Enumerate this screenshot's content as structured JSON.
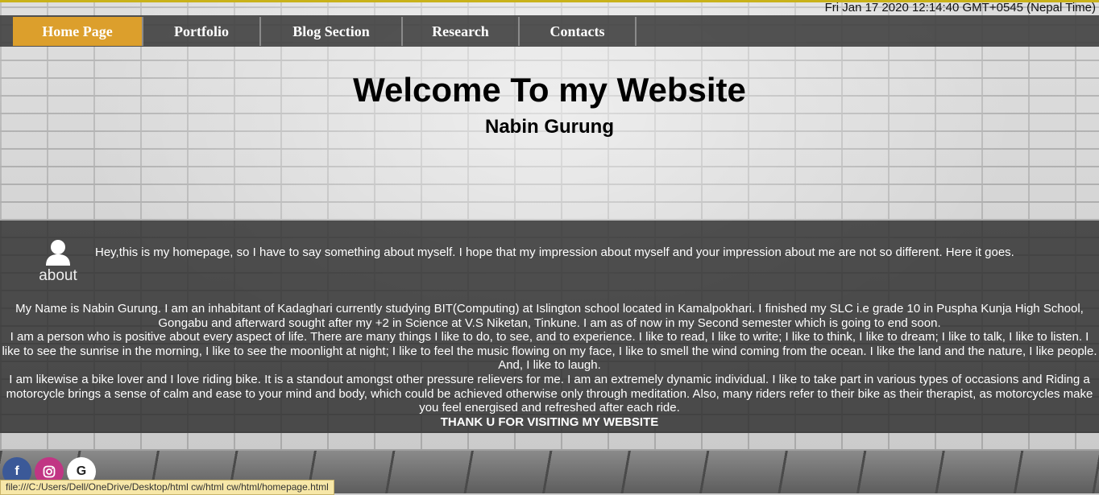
{
  "clock": "Fri Jan 17 2020 12:14:40 GMT+0545 (Nepal Time)",
  "nav": {
    "items": [
      "Home Page",
      "Portfolio",
      "Blog Section",
      "Research",
      "Contacts"
    ],
    "active": "Home Page"
  },
  "hero": {
    "title": "Welcome To my Website",
    "subtitle": "Nabin Gurung"
  },
  "about": {
    "label": "about",
    "intro": "Hey,this is my homepage, so I have to say something about myself. I hope that my impression about myself and your impression about me are not so different. Here it goes.",
    "paragraph1": "My Name is Nabin Gurung. I am an inhabitant of Kadaghari currently studying BIT(Computing) at Islington school located in Kamalpokhari. I finished my SLC i.e grade 10 in Puspha Kunja High School, Gongabu and afterward sought after my +2 in Science at V.S Niketan, Tinkune. I am as of now in my Second semester which is going to end soon.",
    "paragraph2": "I am a person who is positive about every aspect of life. There are many things I like to do, to see, and to experience. I like to read, I like to write; I like to think, I like to dream; I like to talk, I like to listen. I like to see the sunrise in the morning, I like to see the moonlight at night; I like to feel the music flowing on my face, I like to smell the wind coming from the ocean. I like the land and the nature, I like people. And, I like to laugh.",
    "paragraph3": "I am likewise a bike lover and I love riding bike. It is a standout amongst other pressure relievers for me. I am an extremely dynamic individual. I like to take part in various types of occasions and Riding a motorcycle brings a sense of calm and ease to your mind and body, which could be achieved otherwise only through meditation. Also, many riders refer to their bike as their therapist, as motorcycles make you feel energised and refreshed after each ride.",
    "thanks": "THANK U FOR VISITING MY WEBSITE"
  },
  "socials": {
    "facebook": "f",
    "google": "G"
  },
  "statusbar": "file:///C:/Users/Dell/OneDrive/Desktop/html cw/html cw/html/homepage.html",
  "colors": {
    "nav_active": "#dc9f2c",
    "nav_bg": "#3c3c3c",
    "panel_bg": "#2d2d2d"
  }
}
